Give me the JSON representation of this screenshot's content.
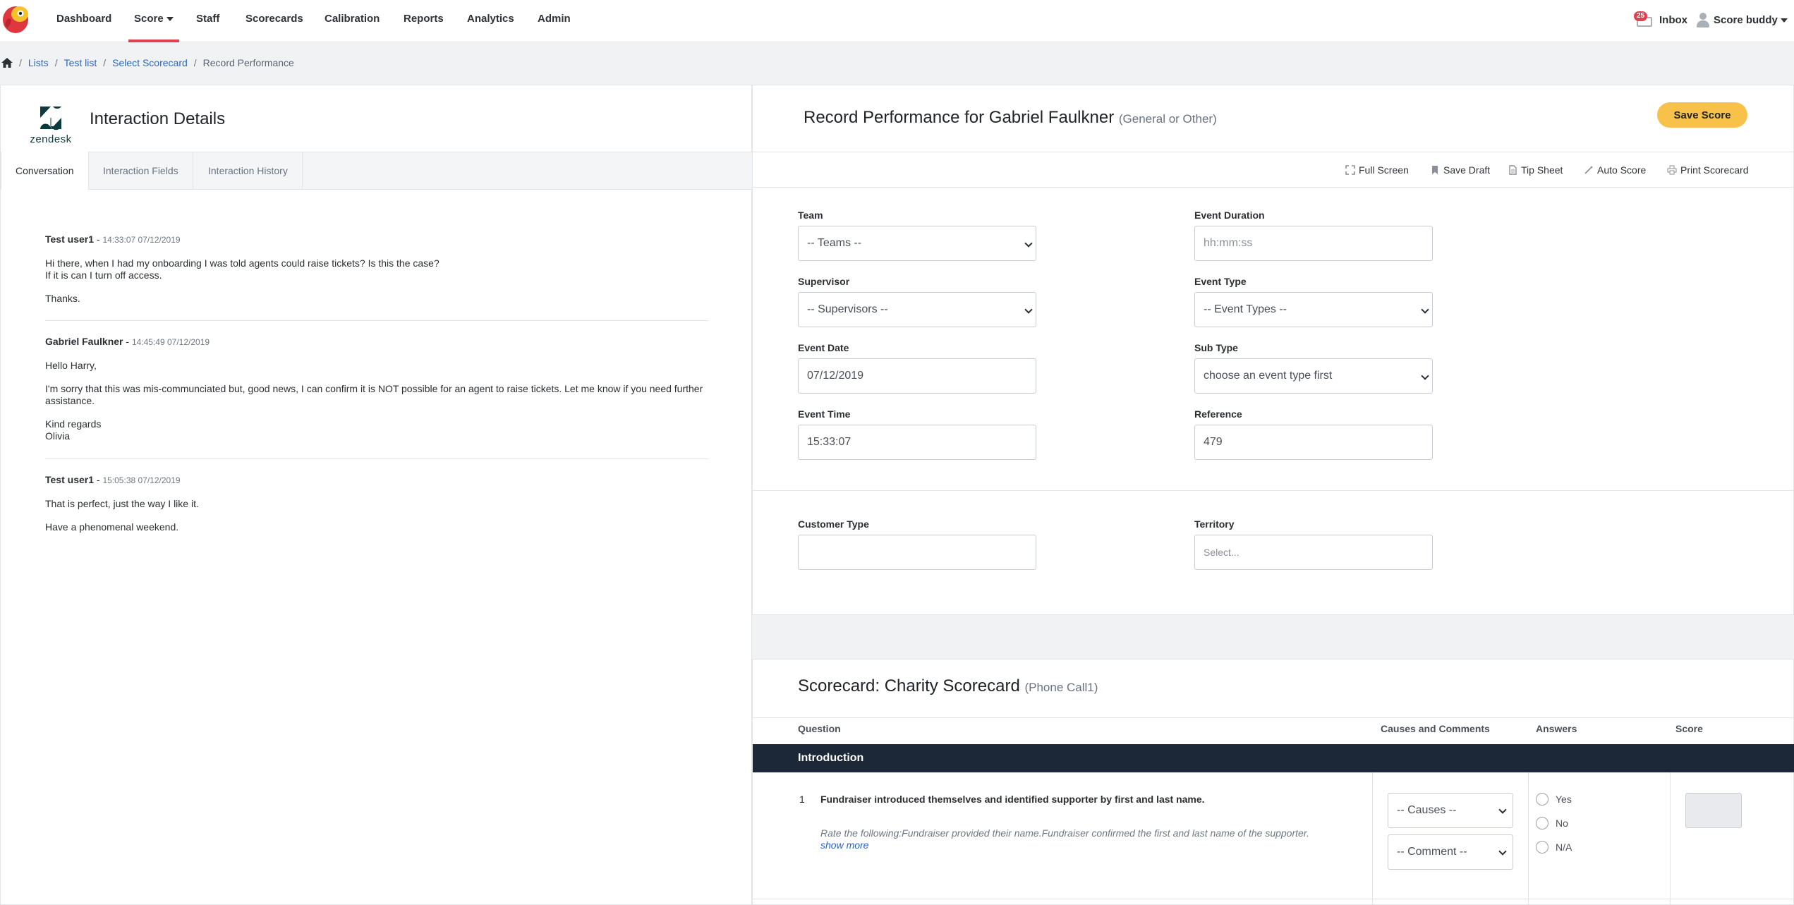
{
  "nav": {
    "items": [
      "Dashboard",
      "Score",
      "Staff",
      "Scorecards",
      "Calibration",
      "Reports",
      "Analytics",
      "Admin"
    ],
    "active": "Score",
    "inbox_count": "25",
    "inbox_label": "Inbox",
    "user_label": "Score buddy"
  },
  "breadcrumb": {
    "items": [
      "Lists",
      "Test list",
      "Select Scorecard"
    ],
    "current": "Record Performance"
  },
  "left": {
    "logo_text": "zendesk",
    "title": "Interaction Details",
    "tabs": [
      "Conversation",
      "Interaction Fields",
      "Interaction History"
    ],
    "messages": [
      {
        "author": "Test user1",
        "time": "14:33:07 07/12/2019",
        "paragraphs": [
          "Hi there, when I had my onboarding I was told agents could raise tickets? Is this the case?\nIf it is can I turn off access.",
          "Thanks."
        ]
      },
      {
        "author": "Gabriel Faulkner",
        "time": "14:45:49 07/12/2019",
        "paragraphs": [
          "Hello Harry,",
          "I'm sorry that this was mis-communciated but, good news, I can confirm it is NOT possible for an agent to raise tickets. Let me know if you need further assistance.",
          "Kind regards\nOlivia"
        ]
      },
      {
        "author": "Test user1",
        "time": "15:05:38 07/12/2019",
        "paragraphs": [
          "That is perfect, just the way I like it.",
          "Have a phenomenal weekend."
        ]
      }
    ]
  },
  "record": {
    "title": "Record Performance for Gabriel Faulkner",
    "subtitle": "(General or Other)",
    "save_label": "Save Score",
    "toolbar": [
      "Full Screen",
      "Save Draft",
      "Tip Sheet",
      "Auto Score",
      "Print Scorecard"
    ],
    "fields": {
      "team": {
        "label": "Team",
        "value": "-- Teams --"
      },
      "supervisor": {
        "label": "Supervisor",
        "value": "-- Supervisors --"
      },
      "event_date": {
        "label": "Event Date",
        "value": "07/12/2019"
      },
      "event_time": {
        "label": "Event Time",
        "value": "15:33:07"
      },
      "event_duration": {
        "label": "Event Duration",
        "placeholder": "hh:mm:ss"
      },
      "event_type": {
        "label": "Event Type",
        "value": "-- Event Types --"
      },
      "sub_type": {
        "label": "Sub Type",
        "value": "choose an event type first"
      },
      "reference": {
        "label": "Reference",
        "value": "479"
      },
      "customer_type": {
        "label": "Customer Type",
        "value": ""
      },
      "territory": {
        "label": "Territory",
        "placeholder": "Select..."
      }
    }
  },
  "scorecard": {
    "title": "Scorecard: Charity Scorecard",
    "subtitle": "(Phone Call1)",
    "columns": [
      "Question",
      "Causes and Comments",
      "Answers",
      "Score"
    ],
    "section": "Introduction",
    "question": {
      "number": "1",
      "text": "Fundraiser introduced themselves and identified supporter by first and last name.",
      "description": "Rate the following:Fundraiser provided their name.Fundraiser confirmed the first and last name of the supporter.",
      "more": "show more",
      "causes": "-- Causes --",
      "comment": "-- Comment --",
      "answers": [
        "Yes",
        "No",
        "N/A"
      ]
    }
  },
  "colors": {
    "accent": "#e0404f",
    "save_button": "#f8c24a",
    "section_bar": "#1c2838",
    "link": "#2566c9"
  }
}
